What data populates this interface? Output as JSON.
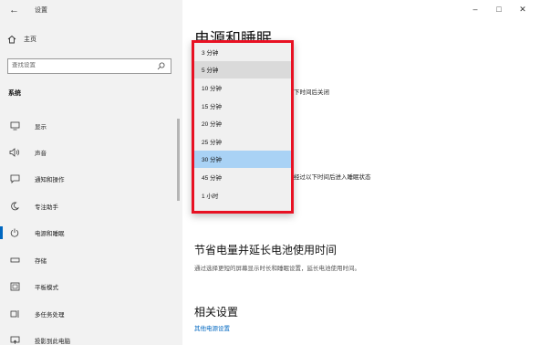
{
  "window": {
    "back_glyph": "←",
    "title": "设置",
    "controls": {
      "minimize": "–",
      "maximize": "□",
      "close": "✕"
    }
  },
  "sidebar": {
    "home_label": "主页",
    "search_placeholder": "查找设置",
    "section_title": "系统",
    "items": [
      {
        "label": "显示",
        "icon": "display-icon"
      },
      {
        "label": "声音",
        "icon": "sound-icon"
      },
      {
        "label": "通知和操作",
        "icon": "notification-icon"
      },
      {
        "label": "专注助手",
        "icon": "focus-assist-icon"
      },
      {
        "label": "电源和睡眠",
        "icon": "power-icon",
        "active": true
      },
      {
        "label": "存储",
        "icon": "storage-icon"
      },
      {
        "label": "平板模式",
        "icon": "tablet-icon"
      },
      {
        "label": "多任务处理",
        "icon": "multitasking-icon"
      },
      {
        "label": "投影到此电脑",
        "icon": "project-icon"
      }
    ]
  },
  "main": {
    "page_title": "电源和睡眠",
    "screen_fragment": "下时间后关闭",
    "sleep_fragment": "经过以下时间后进入睡眠状态",
    "battery_heading": "节省电量并延长电池使用时间",
    "battery_desc": "通过选择更短的屏幕显示时长和睡眠设置，延长电池使用时间。",
    "related_heading": "相关设置",
    "related_link": "其他电源设置"
  },
  "dropdown": {
    "options": [
      "3 分钟",
      "5 分钟",
      "10 分钟",
      "15 分钟",
      "20 分钟",
      "25 分钟",
      "30 分钟",
      "45 分钟",
      "1 小时"
    ],
    "selected": "30 分钟",
    "hovered": "5 分钟",
    "highlight_color": "#e81123"
  },
  "colors": {
    "accent": "#0067c0",
    "selection": "#a9d2f5"
  }
}
